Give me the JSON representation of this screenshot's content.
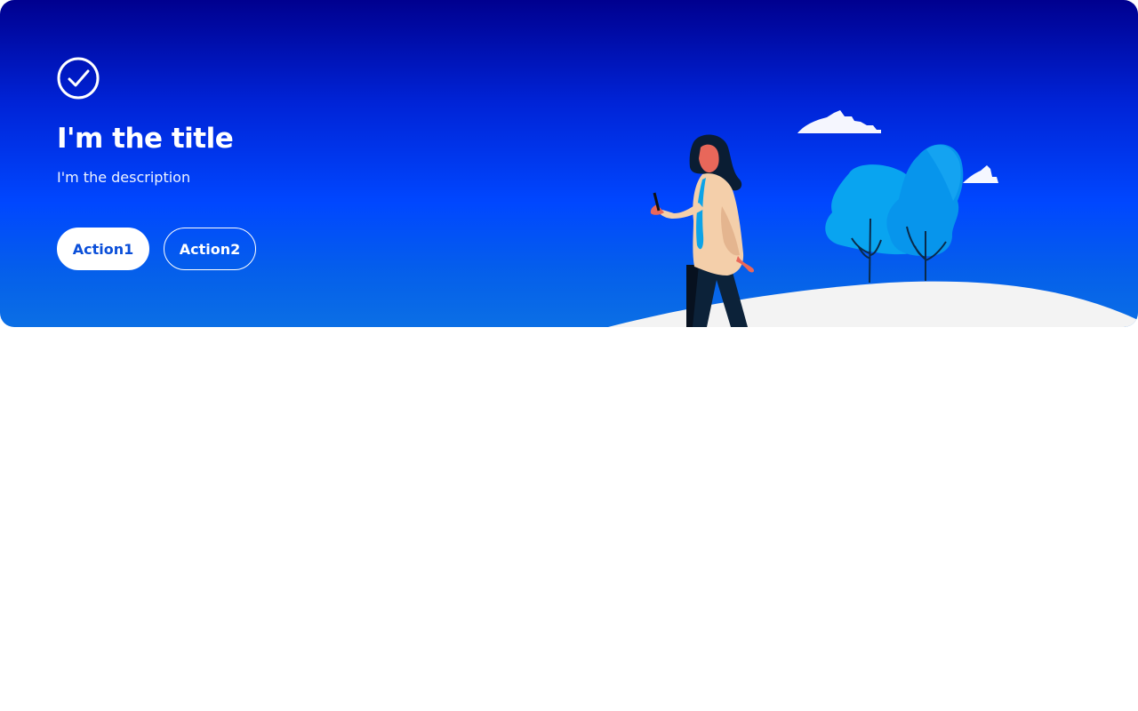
{
  "hero": {
    "title": "I'm the title",
    "description": "I'm the description",
    "status_icon": "check-circle-icon",
    "illustration": "woman-with-phone-trees-clouds-illustration",
    "actions": [
      {
        "label": "Action1",
        "variant": "primary"
      },
      {
        "label": "Action2",
        "variant": "secondary"
      }
    ]
  },
  "colors": {
    "gradient_top": "#00008f",
    "gradient_mid": "#0047ff",
    "gradient_bottom": "#0b6fe5",
    "text": "#ffffff",
    "primary_button_text": "#0b4fd9"
  }
}
